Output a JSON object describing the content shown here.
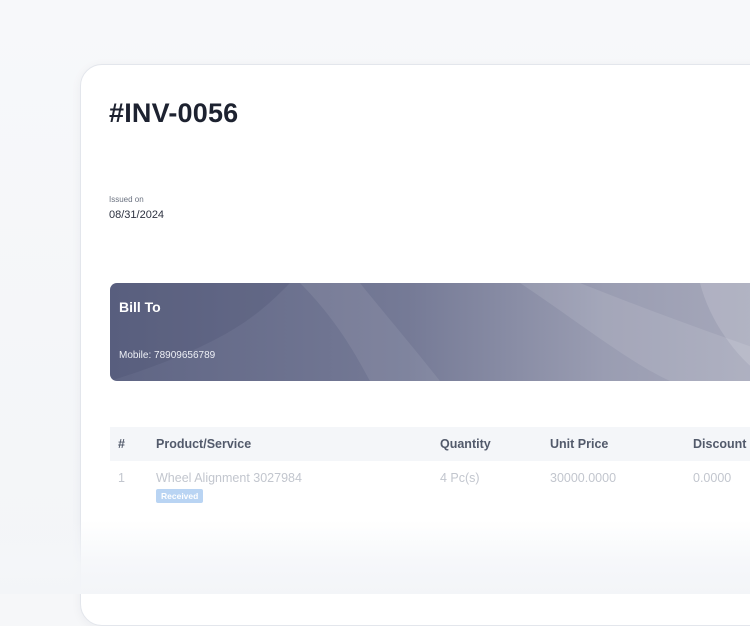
{
  "invoice": {
    "number": "#INV-0056",
    "issued_label": "Issued on",
    "issued_date": "08/31/2024"
  },
  "bill_to": {
    "title": "Bill To",
    "mobile": "Mobile: 78909656789"
  },
  "table": {
    "headers": [
      "#",
      "Product/Service",
      "Quantity",
      "Unit Price",
      "Discount"
    ],
    "rows": [
      {
        "index": "1",
        "product": "Wheel Alignment 3027984",
        "status": "Received",
        "quantity": "4 Pc(s)",
        "unit_price": "30000.0000",
        "discount": "0.0000"
      }
    ]
  }
}
